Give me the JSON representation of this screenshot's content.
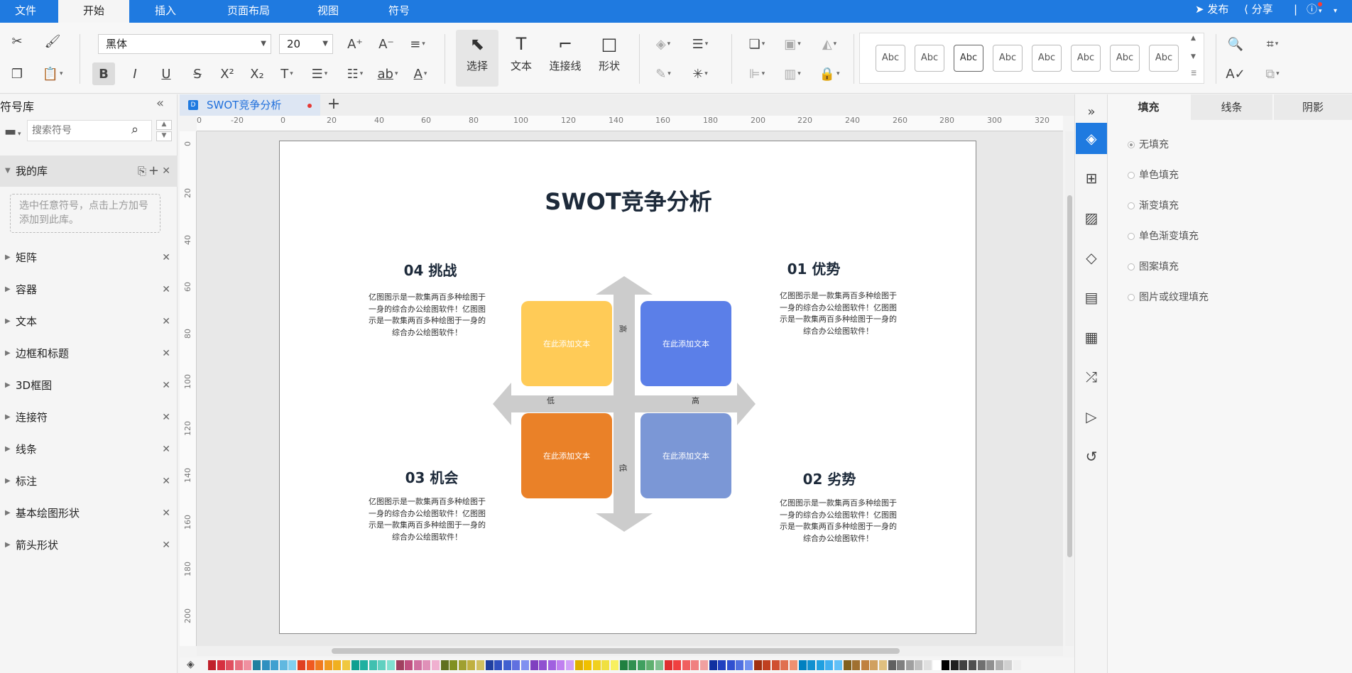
{
  "menu": {
    "tabs": [
      "文件",
      "开始",
      "插入",
      "页面布局",
      "视图",
      "符号"
    ],
    "active_tab": "开始",
    "publish": "发布",
    "share": "分享"
  },
  "ribbon": {
    "font_family": "黑体",
    "font_size": "20",
    "select_label": "选择",
    "text_label": "文本",
    "connector_label": "连接线",
    "shape_label": "形状",
    "style_samples": [
      "Abc",
      "Abc",
      "Abc",
      "Abc",
      "Abc",
      "Abc",
      "Abc",
      "Abc"
    ]
  },
  "left_panel": {
    "title": "符号库",
    "search_placeholder": "搜索符号",
    "my_library": "我的库",
    "my_library_hint": "选中任意符号，点击上方加号添加到此库。",
    "libraries": [
      "矩阵",
      "容器",
      "文本",
      "边框和标题",
      "3D框图",
      "连接符",
      "线条",
      "标注",
      "基本绘图形状",
      "箭头形状"
    ]
  },
  "document": {
    "tab_name": "SWOT竞争分析",
    "ruler_h": [
      "0",
      "-20",
      "0",
      "20",
      "40",
      "60",
      "80",
      "100",
      "120",
      "140",
      "160",
      "180",
      "200",
      "220",
      "240",
      "260",
      "280",
      "300",
      "320"
    ],
    "ruler_v": [
      "0",
      "20",
      "40",
      "60",
      "80",
      "100",
      "120",
      "140",
      "160",
      "180",
      "200"
    ]
  },
  "swot": {
    "title": "SWOT竞争分析",
    "s1_title": "01 优势",
    "s2_title": "02 劣势",
    "s3_title": "03 机会",
    "s4_title": "04 挑战",
    "body_text": "亿图图示是一款集两百多种绘图于一身的综合办公绘图软件！亿图图示是一款集两百多种绘图于一身的综合办公绘图软件！",
    "quad_text": "在此添加文本",
    "axis_high_top": "高",
    "axis_low_left": "低",
    "axis_high_right": "高",
    "axis_low_bottom": "低",
    "colors": {
      "yellow": "#FFCB57",
      "blue": "#5B7FE8",
      "orange": "#EA8128",
      "lightblue": "#7B97D6",
      "arrow": "#CCCCCC"
    }
  },
  "right_panel": {
    "tabs": [
      "填充",
      "线条",
      "阴影"
    ],
    "active_tab": "填充",
    "fill_options": [
      "无填充",
      "单色填充",
      "渐变填充",
      "单色渐变填充",
      "图案填充",
      "图片或纹理填充"
    ],
    "selected_fill": "无填充"
  },
  "palette_colors": [
    "#c0202b",
    "#d63040",
    "#e05060",
    "#e87080",
    "#f090a0",
    "#2080a0",
    "#3090c0",
    "#40a0d0",
    "#60b8e0",
    "#80d0f0",
    "#e04020",
    "#f05a20",
    "#f07a20",
    "#f09a20",
    "#f0b020",
    "#f0c840",
    "#10a090",
    "#20b0a0",
    "#40c0b0",
    "#60d0c0",
    "#80e0d0",
    "#a04060",
    "#c05080",
    "#d070a0",
    "#e090b8",
    "#f0b0d0",
    "#607020",
    "#809020",
    "#a0a030",
    "#c0b040",
    "#d0c060",
    "#2040a0",
    "#3050c0",
    "#4060d0",
    "#6070e0",
    "#8090f0",
    "#8040c0",
    "#9050d0",
    "#a060e0",
    "#c080f0",
    "#d0a0f8",
    "#e0b000",
    "#f0c000",
    "#f0d020",
    "#f0e040",
    "#f8f060",
    "#208040",
    "#309050",
    "#40a060",
    "#60b070",
    "#80c090",
    "#e03030",
    "#f04040",
    "#f06060",
    "#f08080",
    "#f0a0a0",
    "#1030a0",
    "#2040c0",
    "#3050d0",
    "#5070e0",
    "#7090f0",
    "#a03010",
    "#c04020",
    "#d05030",
    "#e07050",
    "#f09070",
    "#0080c0",
    "#1090d0",
    "#20a0e0",
    "#40b0f0",
    "#60c0f8",
    "#806020",
    "#a07030",
    "#c08040",
    "#d0a060",
    "#e0c080",
    "#606060",
    "#808080",
    "#a0a0a0",
    "#c0c0c0",
    "#e0e0e0",
    "#ffffff",
    "#000000",
    "#202020",
    "#404040",
    "#505050",
    "#707070",
    "#909090",
    "#b0b0b0",
    "#d0d0d0",
    "#f0f0f0"
  ]
}
